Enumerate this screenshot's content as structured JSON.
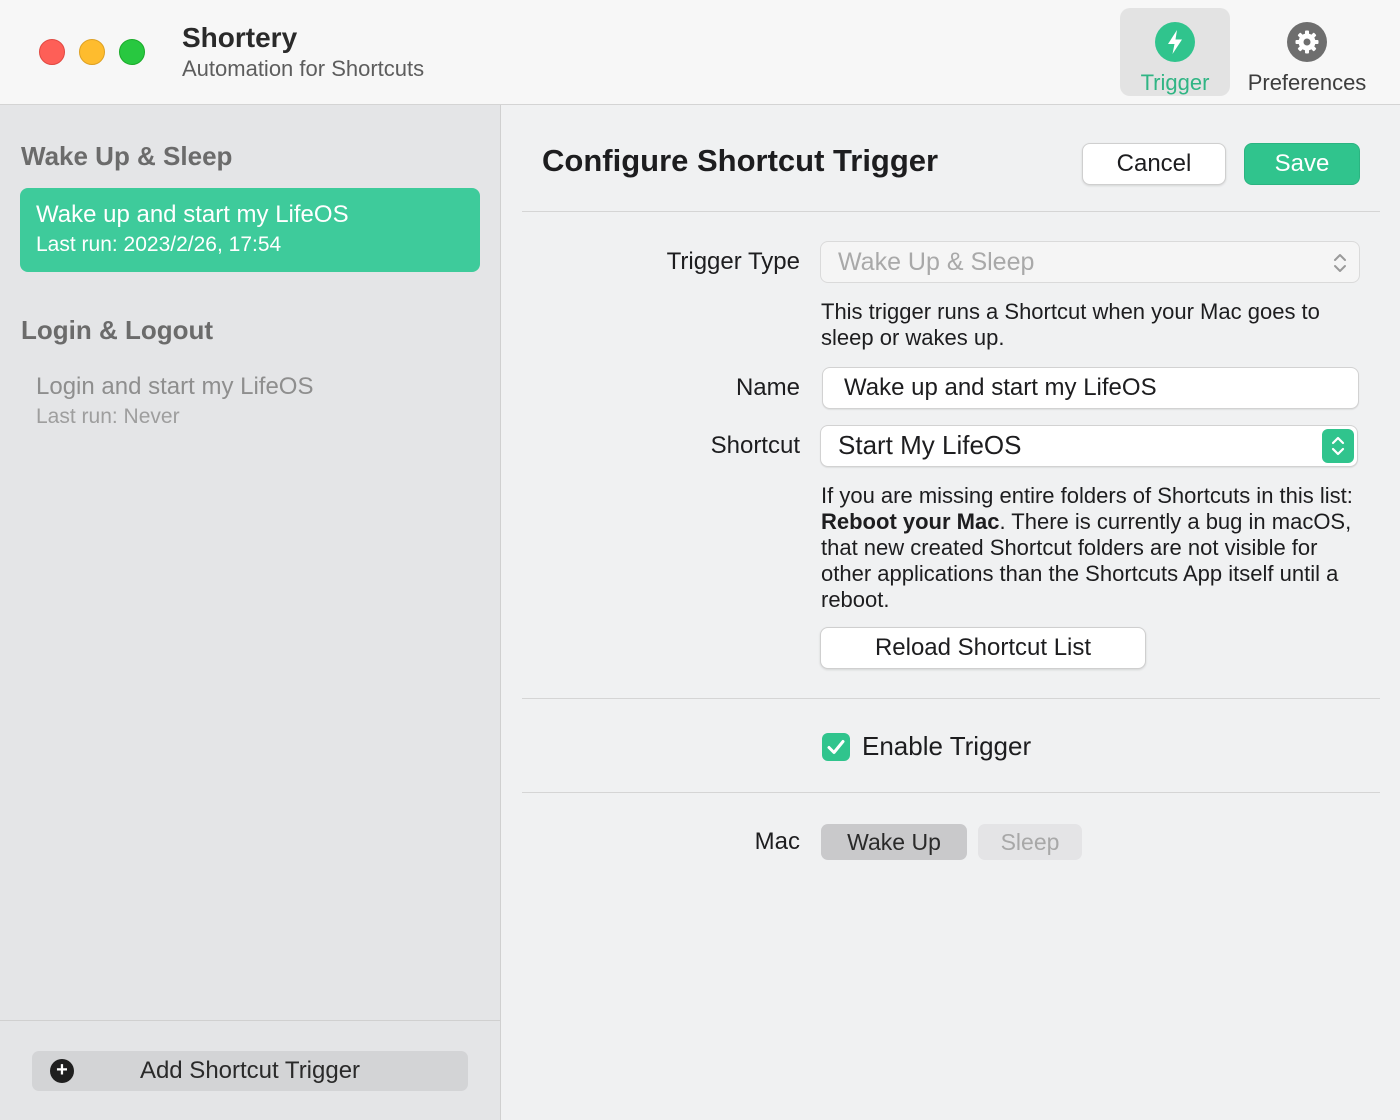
{
  "window": {
    "title": "Shortery",
    "subtitle": "Automation for Shortcuts"
  },
  "toolbar": {
    "trigger_label": "Trigger",
    "preferences_label": "Preferences"
  },
  "sidebar": {
    "sections": [
      {
        "title": "Wake Up & Sleep",
        "items": [
          {
            "title": "Wake up and start my LifeOS",
            "subtitle": "Last run: 2023/2/26, 17:54",
            "selected": true
          }
        ]
      },
      {
        "title": "Login & Logout",
        "items": [
          {
            "title": "Login and start my LifeOS",
            "subtitle": "Last run: Never",
            "selected": false
          }
        ]
      }
    ],
    "add_button_label": "Add Shortcut Trigger"
  },
  "main": {
    "title": "Configure Shortcut Trigger",
    "cancel_label": "Cancel",
    "save_label": "Save",
    "trigger_type": {
      "label": "Trigger Type",
      "value": "Wake Up & Sleep",
      "help": "This trigger runs a Shortcut when your Mac goes to sleep or wakes up."
    },
    "name": {
      "label": "Name",
      "value": "Wake up and start my LifeOS"
    },
    "shortcut": {
      "label": "Shortcut",
      "value": "Start My LifeOS",
      "help_before": "If you are missing entire folders of Shortcuts in this list: ",
      "help_bold": "Reboot your Mac",
      "help_after": ". There is currently a bug in macOS, that new created Shortcut folders are not visible for other applications than the Shortcuts App itself until a reboot.",
      "reload_label": "Reload Shortcut List"
    },
    "enable": {
      "label": "Enable Trigger",
      "checked": true
    },
    "mac": {
      "label": "Mac",
      "options": [
        "Wake Up",
        "Sleep"
      ],
      "selected": "Wake Up"
    }
  },
  "colors": {
    "accent": "#30c48d",
    "selected_item": "#3ecb9b",
    "close": "#fe5f57",
    "minimize": "#febc2e",
    "zoom": "#28c840"
  },
  "icons": {
    "trigger": "bolt-icon",
    "preferences": "gear-icon",
    "add": "plus-circle-icon",
    "checkbox": "checkmark-icon",
    "select": "chevron-updown-icon"
  }
}
